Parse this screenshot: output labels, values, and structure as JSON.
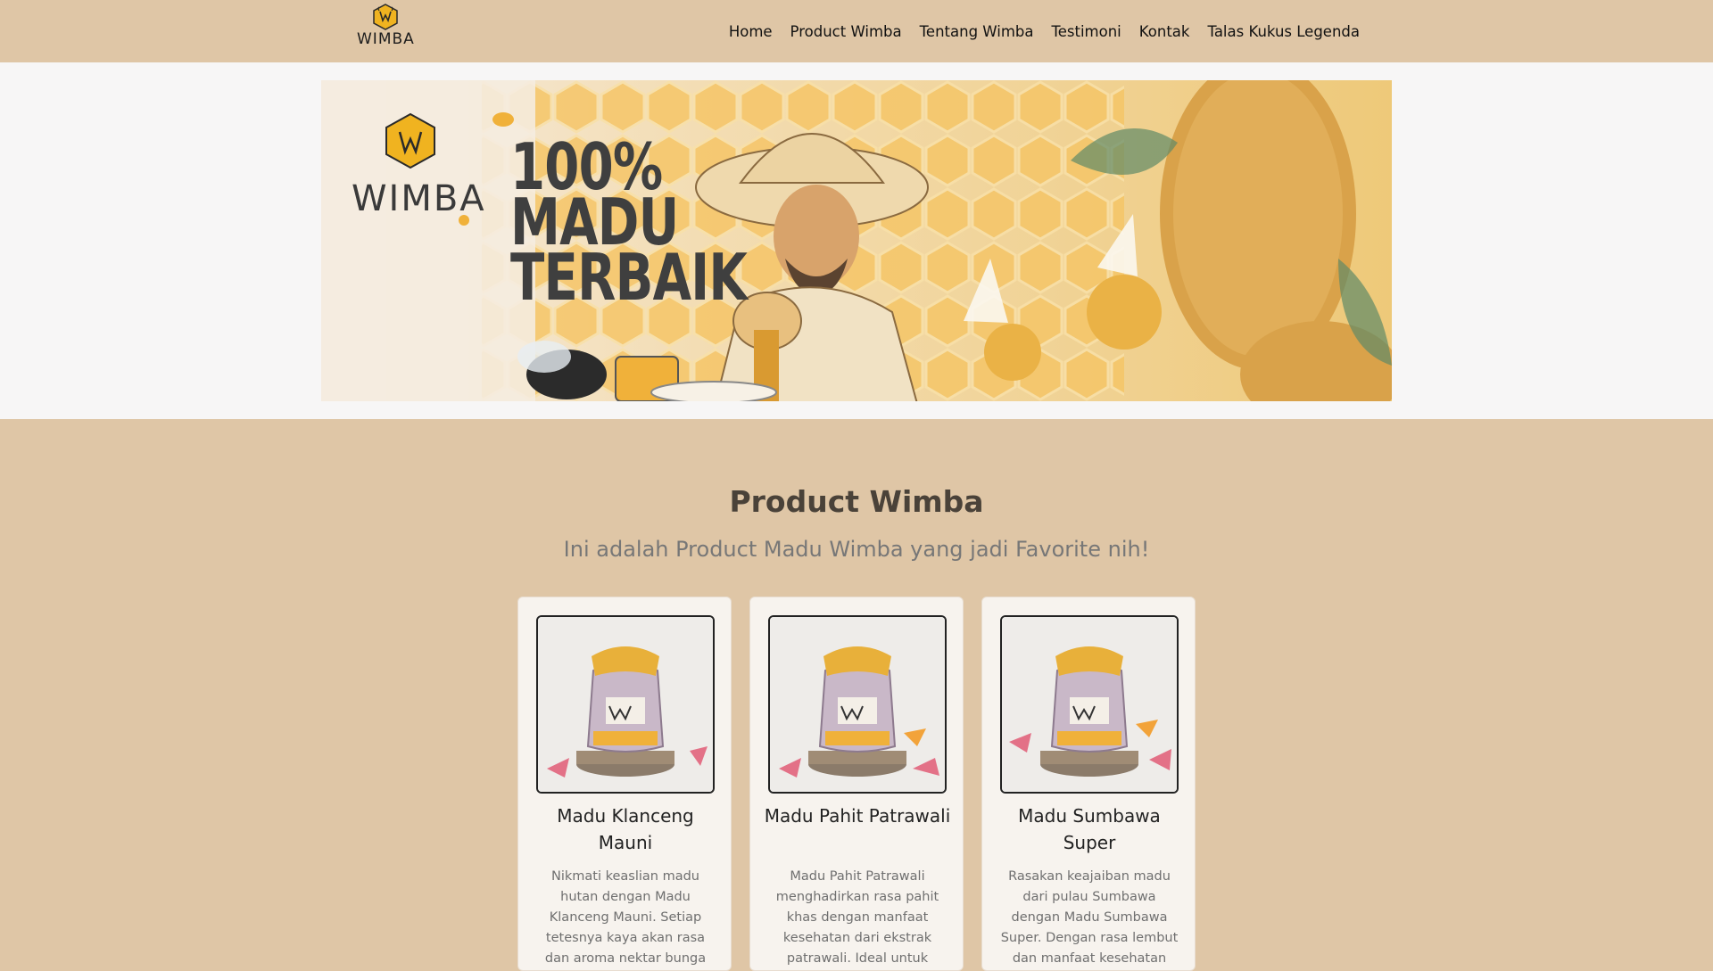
{
  "nav": {
    "brand": "WIMBA",
    "links": [
      "Home",
      "Product Wimba",
      "Tentang Wimba",
      "Testimoni",
      "Kontak",
      "Talas Kukus Legenda"
    ]
  },
  "hero": {
    "brand": "WIMBA",
    "headline": [
      "100%",
      "MADU",
      "TERBAIK"
    ]
  },
  "products": {
    "title": "Product Wimba",
    "subtitle": "Ini adalah Product Madu Wimba yang jadi Favorite nih!",
    "items": [
      {
        "name": "Madu Klanceng Mauni",
        "description": "Nikmati keaslian madu hutan dengan Madu Klanceng Mauni. Setiap tetesnya kaya akan rasa dan aroma nektar bunga"
      },
      {
        "name": "Madu Pahit Patrawali",
        "description": "Madu Pahit Patrawali menghadirkan rasa pahit khas dengan manfaat kesehatan dari ekstrak patrawali. Ideal untuk"
      },
      {
        "name": "Madu Sumbawa Super",
        "description": "Rasakan keajaiban madu dari pulau Sumbawa dengan Madu Sumbawa Super. Dengan rasa lembut dan manfaat kesehatan"
      }
    ]
  },
  "colors": {
    "nav_bg": "#dfc6a6",
    "hero_bg": "#f7f6f6",
    "section_bg": "#dfc6a6",
    "card_bg": "#f7f3ee",
    "honey": "#f0b13a",
    "text_dark": "#4a4239"
  }
}
